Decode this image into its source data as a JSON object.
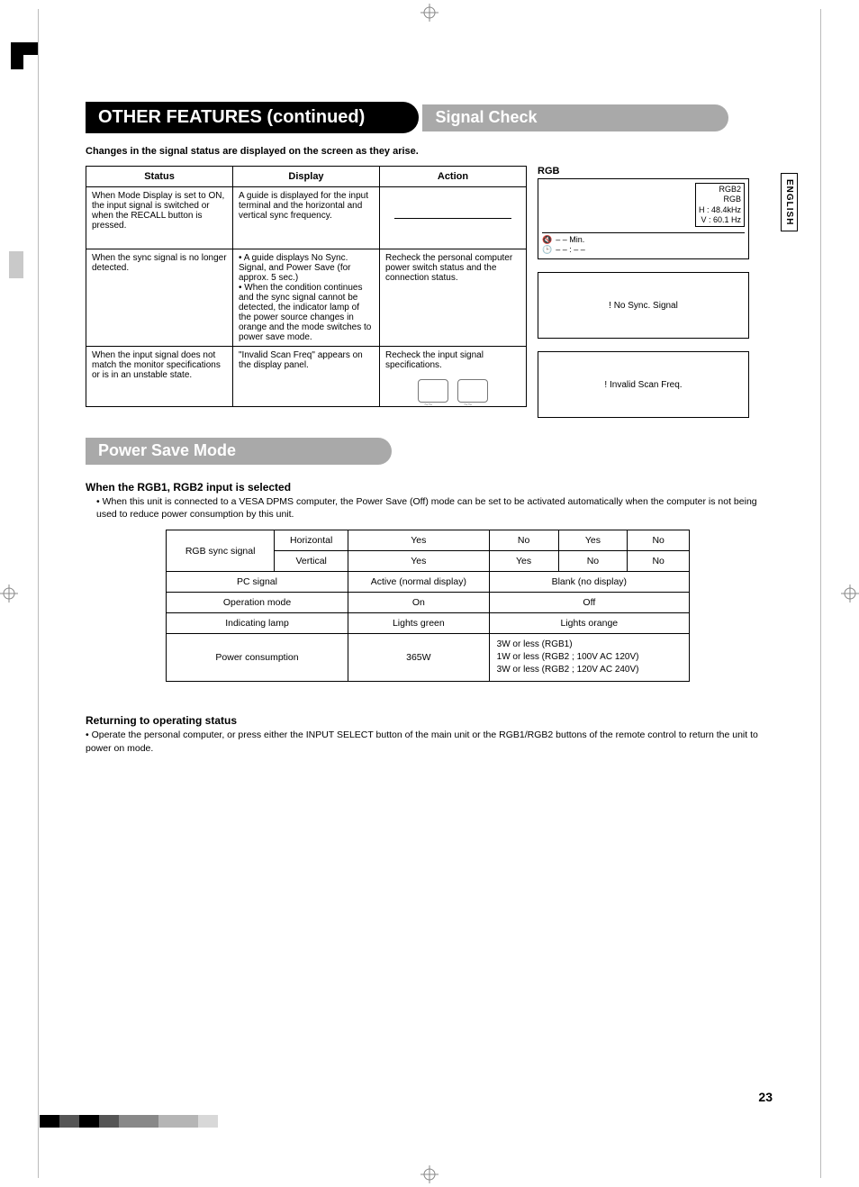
{
  "lang_tab": "ENGLISH",
  "page_number": "23",
  "title": "OTHER FEATURES (continued)",
  "section_signal_check": {
    "heading": "Signal Check",
    "intro": "Changes in the signal status are displayed on the screen as they arise.",
    "headers": {
      "status": "Status",
      "display": "Display",
      "action": "Action"
    },
    "rows": [
      {
        "status": "When Mode Display is set to ON, the input signal is switched or when the RECALL button is pressed.",
        "display": "A guide is displayed for the input terminal and the horizontal and vertical sync frequency.",
        "action": ""
      },
      {
        "status": "When the sync signal is no longer detected.",
        "display": "• A guide displays No Sync. Signal, and Power Save (for approx. 5 sec.)\n• When the condition continues and the sync signal cannot be detected, the indicator lamp of the power source changes in orange and the mode switches to power save mode.",
        "action": "Recheck the personal computer power switch status and the connection status."
      },
      {
        "status": "When the input signal does not match the monitor specifications or is in an unstable state.",
        "display": "\"Invalid Scan Freq\" appears on the display panel.",
        "action": "Recheck the input signal specifications."
      }
    ],
    "side": {
      "label": "RGB",
      "osd": {
        "line1": "RGB2",
        "line2": "RGB",
        "line3": "H :   48.4kHz",
        "line4": "V :   60.1 Hz",
        "bottom1_icon": "speaker-icon",
        "bottom1": "– – Min.",
        "bottom2_icon": "clock-icon",
        "bottom2": "– – : – –"
      },
      "msg_nosync": "! No Sync. Signal",
      "msg_invalid": "! Invalid Scan Freq."
    }
  },
  "section_power_save": {
    "heading": "Power Save Mode",
    "sub1_heading": "When the RGB1, RGB2 input is selected",
    "sub1_note": "When this unit is connected to a VESA DPMS computer, the Power Save (Off) mode can be set to be activated automatically when the computer is not being used to reduce power consumption by this unit.",
    "table": {
      "row_sync_label": "RGB sync signal",
      "row_sync_h_label": "Horizontal",
      "row_sync_v_label": "Vertical",
      "hv": [
        [
          "Yes",
          "No",
          "Yes",
          "No"
        ],
        [
          "Yes",
          "Yes",
          "No",
          "No"
        ]
      ],
      "pc_signal_label": "PC signal",
      "pc_signal_vals": [
        "Active (normal display)",
        "Blank (no display)"
      ],
      "op_mode_label": "Operation mode",
      "op_mode_vals": [
        "On",
        "Off"
      ],
      "lamp_label": "Indicating lamp",
      "lamp_vals": [
        "Lights green",
        "Lights orange"
      ],
      "power_label": "Power consumption",
      "power_on": "365W",
      "power_off_lines": [
        "3W or less (RGB1)",
        "1W or less (RGB2 ; 100V   AC    120V)",
        "3W or less (RGB2 ; 120V   AC    240V)"
      ]
    },
    "sub2_heading": "Returning to operating status",
    "sub2_text": "Operate the personal computer, or press either the INPUT SELECT button of the main unit or the RGB1/RGB2 buttons of the remote control to return the unit to power on mode."
  }
}
